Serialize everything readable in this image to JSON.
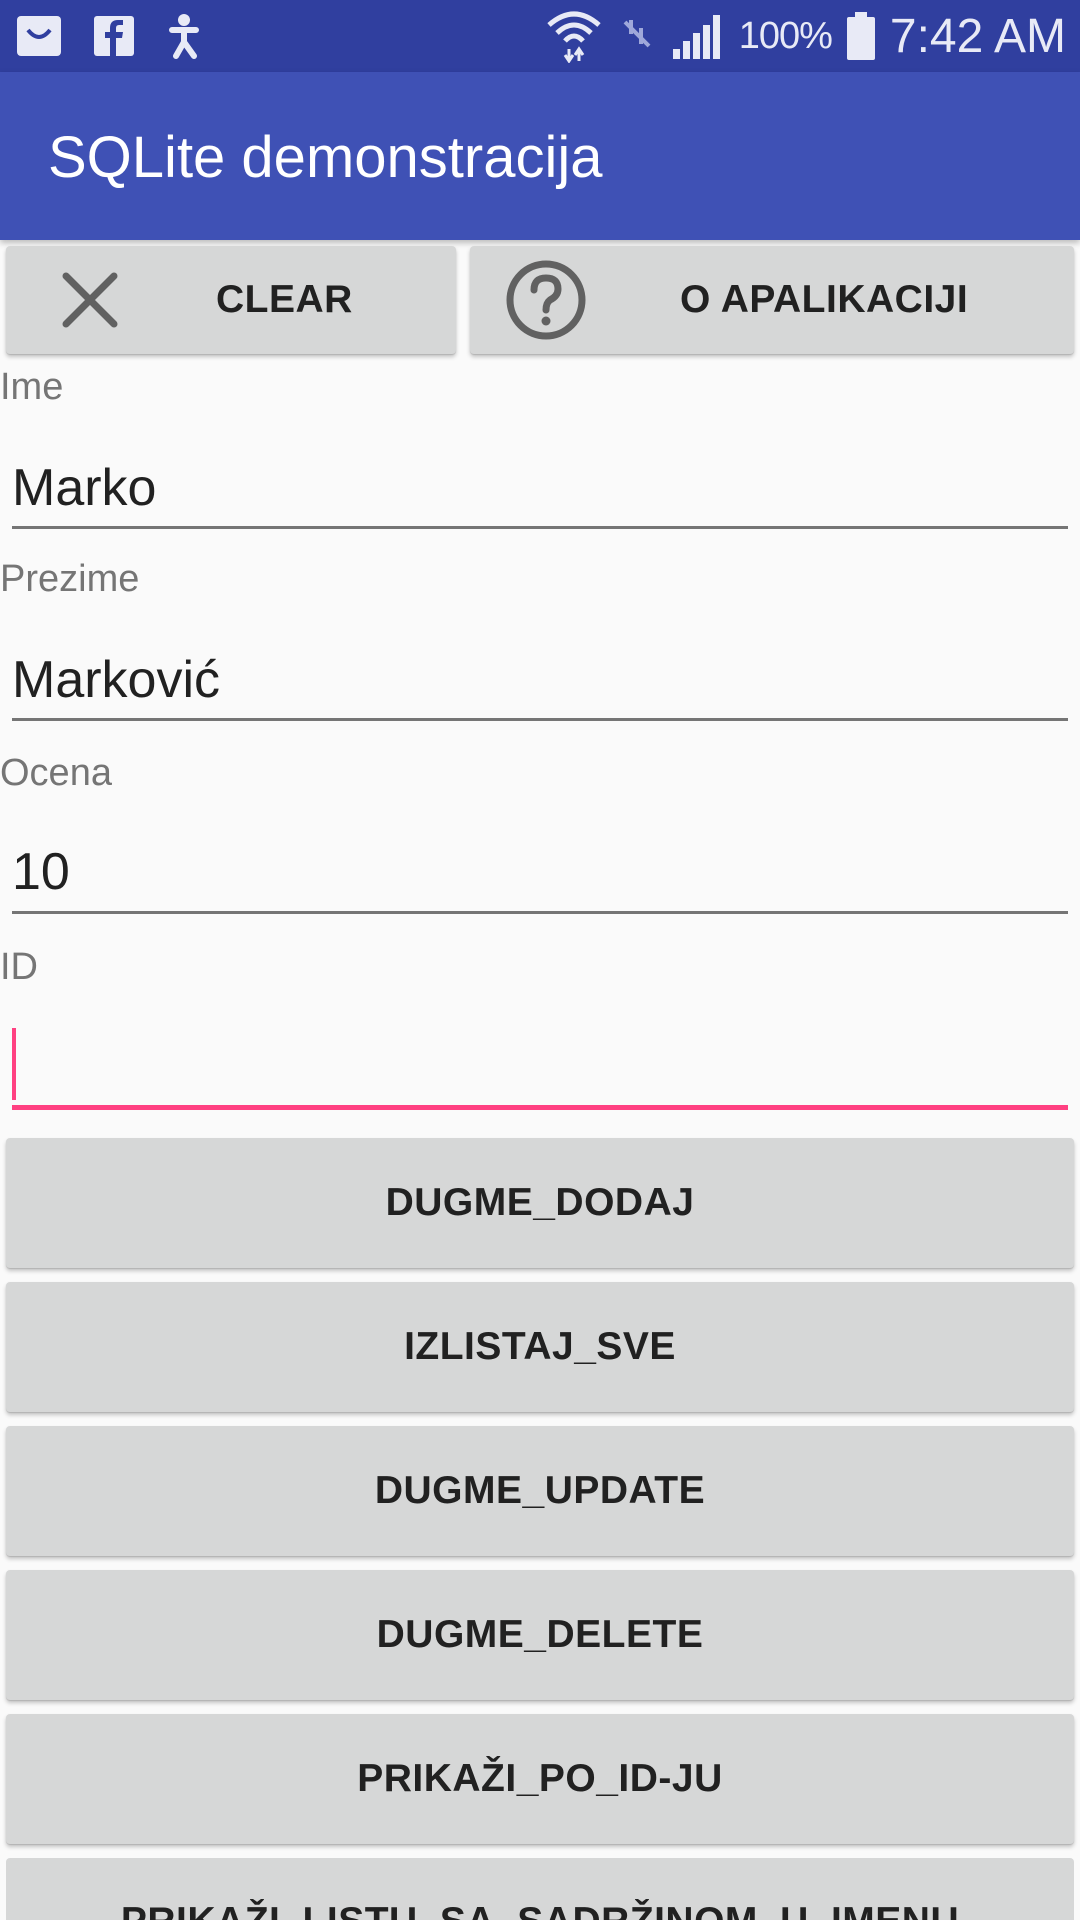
{
  "status_bar": {
    "battery_pct": "100%",
    "time": "7:42 AM",
    "icons": [
      "shopping-bag-icon",
      "facebook-icon",
      "accessibility-icon",
      "wifi-icon",
      "nfc-icon",
      "signal-icon",
      "battery-icon"
    ]
  },
  "app_bar": {
    "title": "SQLite demonstracija"
  },
  "top_buttons": {
    "clear": {
      "label": "CLEAR",
      "icon": "close-icon"
    },
    "about": {
      "label": "O APALIKACIJI",
      "icon": "help-circle-icon"
    }
  },
  "form": {
    "ime": {
      "label": "Ime",
      "value": "Marko"
    },
    "prezime": {
      "label": "Prezime",
      "value": "Marković"
    },
    "ocena": {
      "label": "Ocena",
      "value": "10"
    },
    "id": {
      "label": "ID",
      "value": ""
    }
  },
  "actions": [
    {
      "label": "DUGME_DODAJ"
    },
    {
      "label": "IZLISTAJ_SVE"
    },
    {
      "label": "DUGME_UPDATE"
    },
    {
      "label": "DUGME_DELETE"
    },
    {
      "label": "PRIKAŽI_PO_ID-JU"
    },
    {
      "label": "PRIKAŽI_LISTU_SA_SADRŽINOM_U_IMENU"
    }
  ],
  "colors": {
    "status_bar": "#303f9f",
    "app_bar": "#3f51b5",
    "accent": "#ff4081",
    "button": "#d6d7d7"
  }
}
